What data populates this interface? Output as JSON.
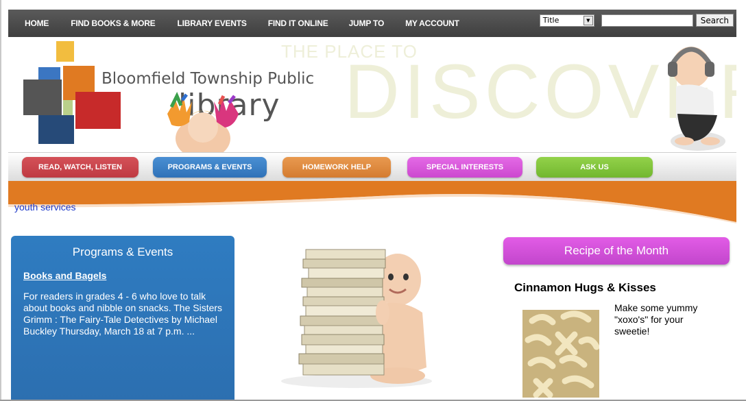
{
  "top_nav": {
    "items": [
      "HOME",
      "FIND BOOKS & MORE",
      "LIBRARY EVENTS",
      "FIND IT ONLINE",
      "JUMP TO",
      "MY ACCOUNT"
    ],
    "search": {
      "select_value": "Title",
      "input_value": "",
      "button_label": "Search"
    }
  },
  "banner": {
    "library_name_line1": "Bloomfield Township Public",
    "library_name_line2": "library",
    "tagline_small": "THE PLACE TO",
    "tagline_big": "DISCOVER"
  },
  "tabs": [
    {
      "label": "READ, WATCH, LISTEN",
      "color": "#c9424a"
    },
    {
      "label": "PROGRAMS & EVENTS",
      "color": "#3a7fc4"
    },
    {
      "label": "HOMEWORK HELP",
      "color": "#e08a3c"
    },
    {
      "label": "SPECIAL INTERESTS",
      "color": "#d850d8"
    },
    {
      "label": "ASK US",
      "color": "#7cc83a"
    }
  ],
  "breadcrumb": "youth services",
  "programs_panel": {
    "title": "Programs & Events",
    "event_link": "Books and Bagels",
    "description": "For readers in grades 4 - 6 who love to talk about books and nibble on snacks. The Sisters Grimm : The Fairy-Tale Detectives by Michael Buckley Thursday, March 18 at 7 p.m. ..."
  },
  "recipe": {
    "button_label": "Recipe of the Month",
    "title": "Cinnamon Hugs & Kisses",
    "description": "Make some yummy \"xoxo's\" for your sweetie!"
  },
  "colors": {
    "topbar": "#4a4a4a",
    "orange_band": "#e07a22",
    "panel_blue": "#2f7cc1",
    "link_blue": "#1d38c8"
  }
}
